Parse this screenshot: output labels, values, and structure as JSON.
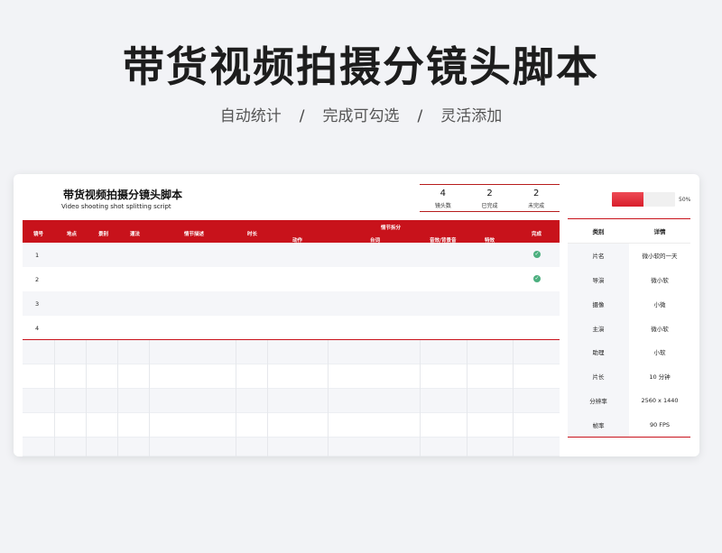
{
  "hero": {
    "title": "带货视频拍摄分镜头脚本",
    "features": [
      "自动统计",
      "完成可勾选",
      "灵活添加"
    ],
    "separator": "/"
  },
  "document": {
    "title": "带货视频拍摄分镜头脚本",
    "subtitle": "Video shooting shot splitting script"
  },
  "stats": [
    {
      "value": "4",
      "label": "镜头数"
    },
    {
      "value": "2",
      "label": "已完成"
    },
    {
      "value": "2",
      "label": "未完成"
    }
  ],
  "progress": {
    "value": 0.5,
    "label": "50%"
  },
  "table": {
    "headers": {
      "no": "镜号",
      "location": "地点",
      "shot": "景别",
      "camera": "運法",
      "desc": "情节描述",
      "duration": "时长",
      "group": "情节拆分",
      "action": "动作",
      "lines": "台词",
      "audio": "音效/背景音",
      "effect": "特效",
      "done": "完成"
    },
    "rows": [
      {
        "no": "1",
        "done": true
      },
      {
        "no": "2",
        "done": true
      },
      {
        "no": "3",
        "done": false
      },
      {
        "no": "4",
        "done": false
      }
    ],
    "check_glyph": "✓"
  },
  "info": {
    "header": {
      "key": "类别",
      "value": "详情"
    },
    "rows": [
      {
        "key": "片名",
        "value": "微小软的一天"
      },
      {
        "key": "导演",
        "value": "微小软"
      },
      {
        "key": "摄像",
        "value": "小微"
      },
      {
        "key": "主演",
        "value": "微小软"
      },
      {
        "key": "助理",
        "value": "小软"
      },
      {
        "key": "片长",
        "value": "10 分钟"
      },
      {
        "key": "分辨率",
        "value": "2560 x 1440"
      },
      {
        "key": "帧率",
        "value": "90 FPS"
      }
    ]
  },
  "colors": {
    "accent": "#c8121b",
    "check": "#4caf7f"
  }
}
